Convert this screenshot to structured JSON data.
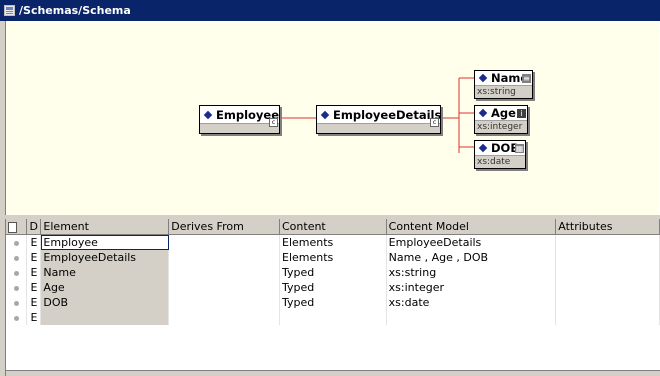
{
  "window": {
    "title": "/Schemas/Schema"
  },
  "diagram": {
    "nodes": [
      {
        "id": "employee",
        "label": "Employee",
        "type": "",
        "badge": "c"
      },
      {
        "id": "employeedetails",
        "label": "EmployeeDetails",
        "type": "",
        "badge": "c"
      },
      {
        "id": "name",
        "label": "Name",
        "type": "xs:string",
        "badge": "list"
      },
      {
        "id": "age",
        "label": "Age",
        "type": "xs:integer",
        "badge": "i"
      },
      {
        "id": "dob",
        "label": "DOB",
        "type": "xs:date",
        "badge": "date"
      }
    ],
    "connector_color": "#e03030"
  },
  "grid": {
    "columns": [
      "",
      "D",
      "Element",
      "Derives From",
      "Content",
      "Content Model",
      "Attributes"
    ],
    "rows": [
      {
        "d": "E",
        "element": "Employee",
        "derives": "",
        "content": "Elements",
        "model": "EmployeeDetails",
        "attributes": ""
      },
      {
        "d": "E",
        "element": "EmployeeDetails",
        "derives": "",
        "content": "Elements",
        "model": "Name , Age , DOB",
        "attributes": ""
      },
      {
        "d": "E",
        "element": "Name",
        "derives": "",
        "content": "Typed",
        "model": "xs:string",
        "attributes": ""
      },
      {
        "d": "E",
        "element": "Age",
        "derives": "",
        "content": "Typed",
        "model": "xs:integer",
        "attributes": ""
      },
      {
        "d": "E",
        "element": "DOB",
        "derives": "",
        "content": "Typed",
        "model": "xs:date",
        "attributes": ""
      },
      {
        "d": "E",
        "element": "",
        "derives": "",
        "content": "",
        "model": "",
        "attributes": ""
      }
    ]
  },
  "colors": {
    "titlebar": "#0a246a",
    "diagram_bg": "#ffffeb",
    "node_diamond": "#1a2b8c"
  }
}
